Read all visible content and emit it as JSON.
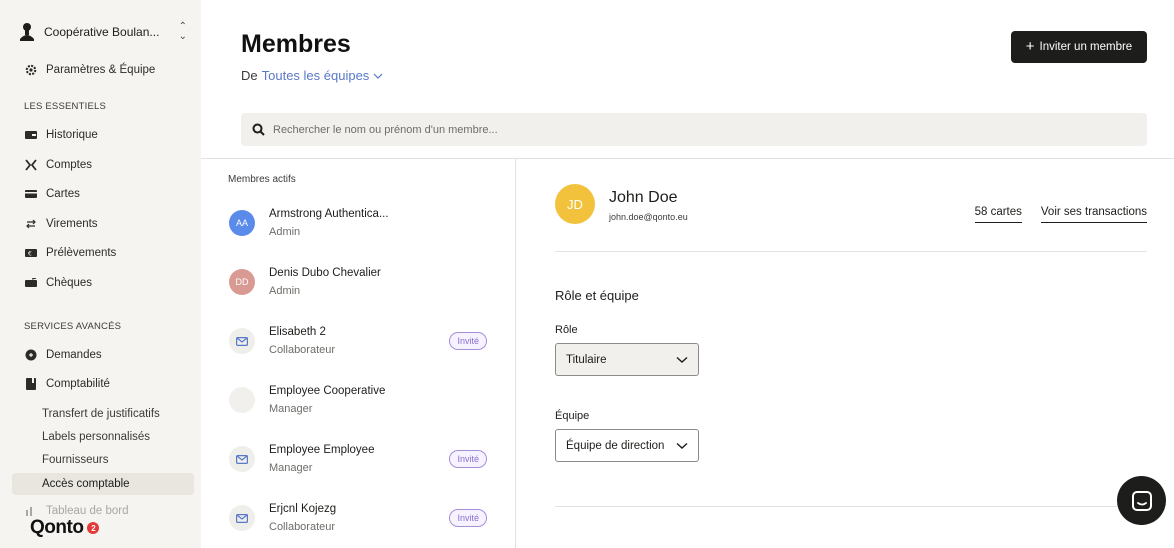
{
  "sidebar": {
    "org_name": "Coopérative Boulan...",
    "settings_label": "Paramètres & Équipe",
    "section_essentials": "LES ESSENTIELS",
    "essentials": [
      "Historique",
      "Comptes",
      "Cartes",
      "Virements",
      "Prélèvements",
      "Chèques"
    ],
    "section_advanced": "SERVICES AVANCÉS",
    "advanced": [
      "Demandes",
      "Comptabilité"
    ],
    "accounting_sub": [
      "Transfert de justificatifs",
      "Labels personnalisés",
      "Fournisseurs",
      "Accès comptable"
    ],
    "cut_item": "Tableau de bord",
    "logo_text": "Qonto",
    "logo_badge": "2"
  },
  "header": {
    "title": "Membres",
    "subtitle_prefix": "De",
    "subtitle_link": "Toutes les équipes",
    "invite_label": "Inviter un membre"
  },
  "search": {
    "placeholder": "Rechercher le nom ou prénom d'un membre..."
  },
  "members": {
    "section_title": "Membres actifs",
    "items": [
      {
        "name": "Armstrong Authentica...",
        "role": "Admin",
        "initials": "AA",
        "avatar_color": "#5b8bea",
        "status": ""
      },
      {
        "name": "Denis Dubo Chevalier",
        "role": "Admin",
        "initials": "DD",
        "avatar_color": "#d99a93",
        "status": ""
      },
      {
        "name": "Elisabeth 2",
        "role": "Collaborateur",
        "initials": "",
        "avatar_color": "#eeeeea",
        "status": "Invité"
      },
      {
        "name": "Employee Cooperative",
        "role": "Manager",
        "initials": "",
        "avatar_color": "#f1f0ec",
        "status": ""
      },
      {
        "name": "Employee Employee",
        "role": "Manager",
        "initials": "",
        "avatar_color": "#eeeeea",
        "status": "Invité"
      },
      {
        "name": "Erjcnl Kojezg",
        "role": "Collaborateur",
        "initials": "",
        "avatar_color": "#eeeeea",
        "status": "Invité"
      }
    ]
  },
  "detail": {
    "initials": "JD",
    "name": "John Doe",
    "email": "john.doe@qonto.eu",
    "cards_link": "58 cartes",
    "transactions_link": "Voir ses transactions",
    "section_title": "Rôle et équipe",
    "role_label": "Rôle",
    "role_value": "Titulaire",
    "team_label": "Équipe",
    "team_value": "Équipe de direction"
  },
  "colors": {
    "accent_link": "#5a78c8",
    "dark": "#1d1d1b",
    "invite_pill": "#8a6fcf",
    "avatar_selected": "#f2c23d"
  }
}
